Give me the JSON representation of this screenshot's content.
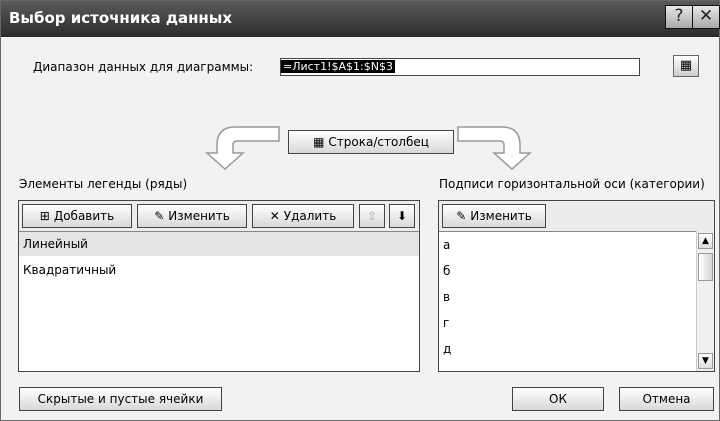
{
  "dialog": {
    "title": "Выбор источника данных",
    "help_label": "?",
    "close_label": "✕"
  },
  "range": {
    "label": "Диапазон данных для диаграммы:",
    "value": "=Лист1!$A$1:$N$3",
    "picker_icon": "range-picker-icon"
  },
  "switch_button": {
    "label": "Строка/столбец",
    "icon": "swap-icon"
  },
  "legend": {
    "label": "Элементы легенды (ряды)",
    "add_label": "Добавить",
    "edit_label": "Изменить",
    "delete_label": "Удалить",
    "up_label": "⇧",
    "down_label": "⬇",
    "items": [
      "Линейный",
      "Квадратичный"
    ],
    "selected_index": 0
  },
  "axis": {
    "label": "Подписи горизонтальной оси (категории)",
    "edit_label": "Изменить",
    "items": [
      "а",
      "б",
      "в",
      "г",
      "д"
    ]
  },
  "footer": {
    "hidden_cells_label": "Скрытые и пустые ячейки",
    "ok_label": "ОК",
    "cancel_label": "Отмена"
  }
}
